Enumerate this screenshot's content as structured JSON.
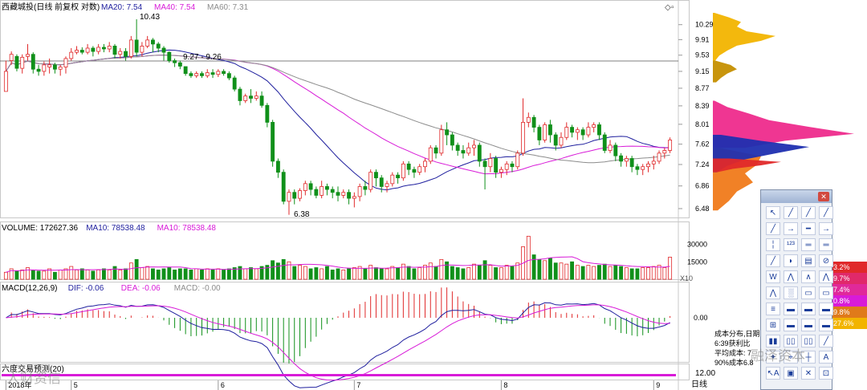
{
  "title": "西藏城投(日线 前复权 对数)",
  "ma_labels": [
    {
      "text": "MA20: 7.54",
      "color": "#1f1f9e"
    },
    {
      "text": "MA40: 7.54",
      "color": "#d81bd8"
    },
    {
      "text": "MA60: 7.31",
      "color": "#8c8c8c"
    }
  ],
  "price_annotations": {
    "high": "10.43",
    "low": "6.38",
    "gap": "9.27 - 9.26"
  },
  "volume_header": [
    {
      "text": "VOLUME: 172627.36",
      "color": "#000000"
    },
    {
      "text": "MA10: 78538.48",
      "color": "#1f1f9e"
    },
    {
      "text": "MA10: 78538.48",
      "color": "#d81bd8"
    }
  ],
  "volume_scale": "X10",
  "macd_header": [
    {
      "text": "MACD(12,26,9)",
      "color": "#000000"
    },
    {
      "text": "DIF: -0.06",
      "color": "#1f1f9e"
    },
    {
      "text": "DEA: -0.06",
      "color": "#d81bd8"
    },
    {
      "text": "MACD: -0.00",
      "color": "#8c8c8c"
    }
  ],
  "bottom_indicator_label": "六度交易预测(20)",
  "bottom_indicator_value": "12.00",
  "x_axis_label": "日线",
  "colors": {
    "up": "#e0292a",
    "down": "#10901a",
    "ma20": "#1f1f9e",
    "ma40": "#d81bd8",
    "ma60": "#8c8c8c",
    "chip_yellow": "#f2b400",
    "chip_pink": "#ee2b8c",
    "chip_orange": "#f07a1a",
    "chip_blue": "#1f2fb0"
  },
  "info_lines": [
    "成本分布,日期",
    "6:39获利比",
    "平均成本: 7",
    "90%成本6.8"
  ],
  "percent_badges": [
    {
      "text": "3.2%",
      "color": "#e0292a"
    },
    {
      "text": "9.7%",
      "color": "#e0296a"
    },
    {
      "text": "7.4%",
      "color": "#e0299a"
    },
    {
      "text": "0.8%",
      "color": "#d81bd8"
    },
    {
      "text": "9.8%",
      "color": "#e07a1a"
    },
    {
      "text": "27.6%",
      "color": "#f2b400"
    }
  ],
  "tools": [
    "↖",
    "╱",
    "╱",
    "╱",
    "╱",
    "→",
    "━",
    "→",
    "╎",
    "¹²³",
    "═",
    "═",
    "╱",
    "◗",
    "▤",
    "⊘",
    "W",
    "⋀",
    "∧",
    "⋀",
    "⋀",
    "░",
    "▭",
    "▭",
    "≡",
    "▬",
    "▬",
    "▬",
    "⊞",
    "▬",
    "▬",
    "▬",
    "▮▮",
    "▯▯",
    "▯▯",
    "╱",
    "✦",
    "⌖",
    "┼",
    "A",
    "↖A",
    "▣",
    "✕",
    "⊡"
  ],
  "watermarks": [
    "人财资信",
    "融泽资本"
  ],
  "chart_data": {
    "type": "candlestick",
    "title": "西藏城投(日线 前复权 对数)",
    "y_scale": "log",
    "ylim": [
      6.35,
      10.6
    ],
    "y_ticks": [
      10.29,
      9.91,
      9.53,
      9.15,
      8.77,
      8.39,
      8.01,
      7.62,
      7.24,
      6.86,
      6.48
    ],
    "x_ticks": [
      {
        "label": "2018年",
        "index": 0
      },
      {
        "label": "5",
        "index": 12
      },
      {
        "label": "6",
        "index": 39
      },
      {
        "label": "7",
        "index": 64
      },
      {
        "label": "8",
        "index": 91
      },
      {
        "label": "9",
        "index": 119
      }
    ],
    "candles": [
      [
        8.7,
        9.15,
        9.0,
        9.4
      ],
      [
        9.4,
        9.55,
        9.3,
        9.62
      ],
      [
        9.5,
        9.22,
        9.15,
        9.55
      ],
      [
        9.22,
        9.48,
        9.1,
        9.55
      ],
      [
        9.5,
        9.55,
        9.4,
        9.8
      ],
      [
        9.55,
        9.2,
        9.1,
        9.6
      ],
      [
        9.2,
        9.15,
        9.05,
        9.3
      ],
      [
        9.15,
        9.3,
        9.05,
        9.38
      ],
      [
        9.25,
        9.3,
        9.1,
        9.45
      ],
      [
        9.3,
        9.2,
        9.1,
        9.35
      ],
      [
        9.2,
        9.25,
        9.05,
        9.3
      ],
      [
        9.25,
        9.45,
        9.1,
        9.5
      ],
      [
        9.45,
        9.6,
        9.4,
        9.7
      ],
      [
        9.6,
        9.65,
        9.55,
        9.75
      ],
      [
        9.65,
        9.6,
        9.55,
        9.72
      ],
      [
        9.6,
        9.7,
        9.55,
        9.8
      ],
      [
        9.7,
        9.62,
        9.5,
        9.75
      ],
      [
        9.62,
        9.72,
        9.55,
        9.8
      ],
      [
        9.72,
        9.68,
        9.6,
        9.8
      ],
      [
        9.68,
        9.75,
        9.6,
        9.85
      ],
      [
        9.75,
        9.55,
        9.45,
        9.8
      ],
      [
        9.55,
        9.62,
        9.45,
        9.7
      ],
      [
        9.62,
        9.5,
        9.4,
        9.7
      ],
      [
        9.5,
        9.9,
        9.45,
        10.0
      ],
      [
        9.9,
        9.6,
        9.5,
        10.43
      ],
      [
        9.6,
        9.75,
        9.5,
        9.85
      ],
      [
        9.75,
        9.9,
        9.7,
        10.0
      ],
      [
        9.9,
        9.8,
        9.6,
        9.95
      ],
      [
        9.8,
        9.7,
        9.6,
        9.85
      ],
      [
        9.7,
        9.6,
        9.4,
        9.75
      ],
      [
        9.6,
        9.4,
        9.35,
        9.62
      ],
      [
        9.4,
        9.35,
        9.25,
        9.45
      ],
      [
        9.35,
        9.27,
        9.2,
        9.4
      ],
      [
        9.26,
        9.1,
        9.05,
        9.26
      ],
      [
        9.1,
        9.05,
        9.0,
        9.15
      ],
      [
        9.05,
        9.1,
        9.0,
        9.15
      ],
      [
        9.1,
        9.05,
        9.0,
        9.15
      ],
      [
        9.05,
        9.12,
        9.0,
        9.2
      ],
      [
        9.12,
        9.08,
        9.0,
        9.2
      ],
      [
        9.08,
        9.15,
        9.02,
        9.2
      ],
      [
        9.15,
        9.1,
        9.05,
        9.2
      ],
      [
        9.1,
        9.0,
        8.95,
        9.15
      ],
      [
        9.0,
        8.75,
        8.7,
        9.05
      ],
      [
        8.75,
        8.5,
        8.4,
        8.8
      ],
      [
        8.5,
        8.6,
        8.45,
        8.65
      ],
      [
        8.6,
        8.55,
        8.45,
        8.75
      ],
      [
        8.55,
        8.6,
        8.5,
        8.7
      ],
      [
        8.6,
        8.4,
        8.35,
        8.7
      ],
      [
        8.4,
        8.05,
        7.95,
        8.45
      ],
      [
        8.05,
        7.3,
        7.2,
        8.1
      ],
      [
        7.3,
        7.1,
        7.0,
        7.35
      ],
      [
        7.1,
        6.6,
        6.55,
        7.15
      ],
      [
        6.6,
        6.75,
        6.38,
        6.8
      ],
      [
        6.75,
        6.65,
        6.55,
        6.8
      ],
      [
        6.65,
        6.78,
        6.6,
        6.82
      ],
      [
        6.78,
        6.9,
        6.7,
        6.95
      ],
      [
        6.9,
        6.8,
        6.7,
        6.95
      ],
      [
        6.8,
        6.7,
        6.65,
        6.85
      ],
      [
        6.7,
        6.85,
        6.65,
        6.95
      ],
      [
        6.85,
        6.8,
        6.7,
        6.9
      ],
      [
        6.8,
        6.75,
        6.65,
        6.85
      ],
      [
        6.75,
        6.7,
        6.6,
        6.85
      ],
      [
        6.7,
        6.75,
        6.65,
        6.8
      ],
      [
        6.75,
        6.65,
        6.55,
        6.8
      ],
      [
        6.65,
        6.68,
        6.5,
        6.75
      ],
      [
        6.68,
        6.85,
        6.6,
        6.9
      ],
      [
        6.85,
        6.8,
        6.7,
        6.95
      ],
      [
        6.8,
        7.1,
        6.75,
        7.15
      ],
      [
        7.1,
        7.0,
        6.85,
        7.15
      ],
      [
        7.0,
        6.85,
        6.75,
        7.05
      ],
      [
        6.85,
        6.9,
        6.75,
        6.95
      ],
      [
        6.9,
        7.05,
        6.85,
        7.1
      ],
      [
        7.05,
        7.0,
        6.9,
        7.1
      ],
      [
        7.0,
        7.25,
        6.95,
        7.3
      ],
      [
        7.25,
        7.15,
        7.05,
        7.3
      ],
      [
        7.15,
        7.1,
        7.0,
        7.2
      ],
      [
        7.1,
        7.2,
        7.05,
        7.25
      ],
      [
        7.2,
        7.3,
        7.1,
        7.35
      ],
      [
        7.3,
        7.55,
        7.25,
        7.6
      ],
      [
        7.55,
        7.45,
        7.35,
        7.6
      ],
      [
        7.45,
        7.9,
        7.4,
        8.0
      ],
      [
        7.9,
        7.8,
        7.6,
        8.05
      ],
      [
        7.8,
        7.6,
        7.5,
        7.85
      ],
      [
        7.6,
        7.5,
        7.4,
        7.65
      ],
      [
        7.5,
        7.45,
        7.35,
        7.6
      ],
      [
        7.45,
        7.55,
        7.4,
        7.65
      ],
      [
        7.55,
        7.6,
        7.4,
        7.7
      ],
      [
        7.6,
        7.3,
        7.2,
        7.65
      ],
      [
        7.3,
        7.2,
        6.8,
        7.35
      ],
      [
        7.2,
        7.35,
        7.1,
        7.45
      ],
      [
        7.35,
        7.1,
        7.0,
        7.4
      ],
      [
        7.1,
        7.15,
        7.0,
        7.2
      ],
      [
        7.15,
        7.25,
        7.05,
        7.3
      ],
      [
        7.25,
        7.2,
        7.1,
        7.3
      ],
      [
        7.2,
        7.45,
        7.15,
        7.5
      ],
      [
        7.45,
        8.05,
        7.4,
        8.55
      ],
      [
        8.05,
        8.15,
        7.95,
        8.25
      ],
      [
        8.15,
        7.95,
        7.85,
        8.2
      ],
      [
        7.95,
        7.7,
        7.6,
        8.0
      ],
      [
        7.7,
        8.0,
        7.65,
        8.05
      ],
      [
        8.0,
        7.8,
        7.65,
        8.1
      ],
      [
        7.8,
        7.6,
        7.5,
        7.85
      ],
      [
        7.6,
        7.75,
        7.55,
        7.85
      ],
      [
        7.75,
        7.95,
        7.7,
        8.05
      ],
      [
        7.95,
        7.85,
        7.75,
        8.0
      ],
      [
        7.85,
        7.9,
        7.7,
        7.95
      ],
      [
        7.9,
        7.8,
        7.7,
        7.95
      ],
      [
        7.8,
        7.95,
        7.75,
        8.05
      ],
      [
        7.95,
        8.0,
        7.85,
        8.05
      ],
      [
        8.0,
        7.8,
        7.7,
        8.05
      ],
      [
        7.8,
        7.5,
        7.45,
        7.85
      ],
      [
        7.5,
        7.6,
        7.45,
        7.7
      ],
      [
        7.6,
        7.4,
        7.3,
        7.65
      ],
      [
        7.4,
        7.3,
        7.2,
        7.45
      ],
      [
        7.3,
        7.35,
        7.2,
        7.4
      ],
      [
        7.35,
        7.2,
        7.1,
        7.4
      ],
      [
        7.2,
        7.15,
        7.05,
        7.25
      ],
      [
        7.15,
        7.2,
        7.05,
        7.25
      ],
      [
        7.2,
        7.25,
        7.1,
        7.3
      ],
      [
        7.25,
        7.3,
        7.15,
        7.4
      ],
      [
        7.3,
        7.45,
        7.25,
        7.5
      ],
      [
        7.45,
        7.5,
        7.35,
        7.55
      ],
      [
        7.5,
        7.7,
        7.45,
        7.75
      ]
    ],
    "volume": {
      "ylim": [
        0,
        40000
      ],
      "y_ticks": [
        30000,
        15000
      ],
      "values": [
        6,
        9,
        7,
        8,
        10,
        8,
        7,
        7,
        9,
        6,
        8,
        9,
        11,
        8,
        9,
        8,
        7,
        8,
        9,
        8,
        11,
        8,
        9,
        14,
        17,
        10,
        11,
        9,
        8,
        9,
        10,
        8,
        9,
        9,
        8,
        9,
        8,
        9,
        8,
        9,
        8,
        9,
        10,
        11,
        9,
        10,
        9,
        11,
        12,
        16,
        14,
        17,
        15,
        11,
        12,
        11,
        9,
        10,
        9,
        11,
        8,
        9,
        8,
        9,
        10,
        11,
        9,
        12,
        10,
        9,
        9,
        11,
        10,
        13,
        11,
        9,
        10,
        12,
        14,
        11,
        17,
        15,
        11,
        10,
        9,
        10,
        13,
        12,
        16,
        12,
        10,
        10,
        12,
        11,
        14,
        28,
        37,
        21,
        17,
        16,
        18,
        14,
        14,
        13,
        15,
        12,
        11,
        12,
        11,
        12,
        13,
        11,
        12,
        11,
        10,
        9,
        9,
        10,
        10,
        11,
        12,
        10,
        19
      ]
    },
    "macd": {
      "y_ticks": [
        0.0
      ],
      "hist_range": [
        -0.28,
        0.16
      ]
    },
    "chip_distribution": {
      "price_levels": [
        10.29,
        9.91,
        9.53,
        9.15,
        8.77,
        8.39,
        8.01,
        7.62,
        7.24,
        6.86,
        6.48
      ]
    }
  }
}
